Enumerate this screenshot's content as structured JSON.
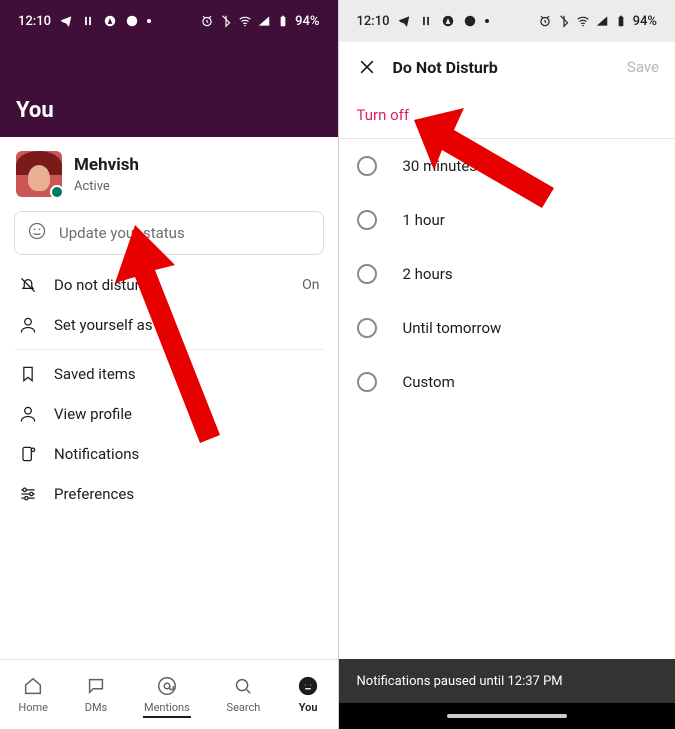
{
  "status_bar": {
    "time": "12:10",
    "battery": "94%"
  },
  "left": {
    "header_title": "You",
    "profile": {
      "name": "Mehvish",
      "presence": "Active"
    },
    "status_placeholder": "Update your status",
    "rows": {
      "dnd": {
        "label": "Do not disturb",
        "trail": "On"
      },
      "away": {
        "label": "Set yourself as"
      },
      "saved": {
        "label": "Saved items"
      },
      "viewprof": {
        "label": "View profile"
      },
      "notif": {
        "label": "Notifications"
      },
      "prefs": {
        "label": "Preferences"
      }
    },
    "tabs": {
      "home": "Home",
      "dms": "DMs",
      "mentions": "Mentions",
      "search": "Search",
      "you": "You"
    }
  },
  "right": {
    "title": "Do Not Disturb",
    "save": "Save",
    "turn_off": "Turn off",
    "options": {
      "opt30": "30 minutes",
      "opt1h": "1 hour",
      "opt2h": "2 hours",
      "opttom": "Until tomorrow",
      "optcustom": "Custom"
    },
    "toast": "Notifications paused until 12:37 PM"
  }
}
